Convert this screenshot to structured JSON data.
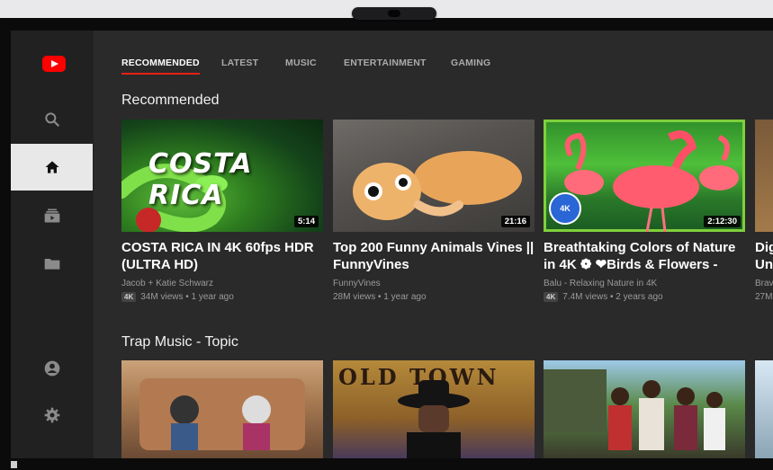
{
  "sidebar": {
    "items": [
      {
        "name": "youtube-logo"
      },
      {
        "name": "search-icon"
      },
      {
        "name": "home-icon",
        "active": true
      },
      {
        "name": "subscriptions-icon"
      },
      {
        "name": "library-icon"
      },
      {
        "name": "account-icon"
      },
      {
        "name": "settings-icon"
      }
    ]
  },
  "tabs": [
    {
      "label": "RECOMMENDED",
      "active": true
    },
    {
      "label": "LATEST"
    },
    {
      "label": "MUSIC"
    },
    {
      "label": "ENTERTAINMENT"
    },
    {
      "label": "GAMING"
    }
  ],
  "sections": [
    {
      "title": "Recommended",
      "videos": [
        {
          "title": "COSTA RICA IN 4K 60fps HDR (ULTRA HD)",
          "thumb_text": "COSTA RICA",
          "channel": "Jacob + Katie Schwarz",
          "badge": "4K",
          "stats": "34M views • 1 year ago",
          "duration": "5:14"
        },
        {
          "title": "Top 200 Funny Animals Vines || FunnyVines",
          "channel": "FunnyVines",
          "stats": "28M views • 1 year ago",
          "duration": "21:16"
        },
        {
          "title": "Breathtaking Colors of Nature in 4K ❁ ❤Birds & Flowers -",
          "channel": "Balu - Relaxing Nature in 4K",
          "badge": "4K",
          "badge2": "4K",
          "stats": "7.4M views • 2 years ago",
          "duration": "2:12:30"
        },
        {
          "title": "Dig Un",
          "channel": "Brav",
          "stats": "27M"
        }
      ]
    },
    {
      "title": "Trap Music - Topic",
      "videos": [
        {
          "thumb_text": ""
        },
        {
          "thumb_text": "OLD TOWN"
        },
        {
          "thumb_text": ""
        }
      ]
    }
  ],
  "colors": {
    "accent": "#e62117",
    "selected_outline": "#7ed03b",
    "background": "#2a2a2a",
    "sidebar": "#212121"
  }
}
